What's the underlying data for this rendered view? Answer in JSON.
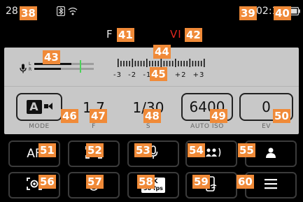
{
  "status": {
    "shots_left": "28",
    "bluetooth_icon": "bluetooth-icon",
    "wifi_icon": "wifi-icon",
    "time": "02:1",
    "battery_icon": "battery-icon"
  },
  "modes": {
    "photo_label": "F",
    "video_label": "VI"
  },
  "audio": {
    "mic_icon": "microphone-icon",
    "left_channel": "L",
    "right_channel": "R",
    "left_level": 0.62,
    "right_level": 0.45
  },
  "ev_scale": {
    "labels": [
      "-3",
      "-2",
      "-1",
      "",
      "+2",
      "+3"
    ]
  },
  "exposure": {
    "mode_value": "A",
    "mode_caption": "MODE",
    "aperture_value": "1.7",
    "aperture_caption": "F",
    "shutter_value": "1/30",
    "shutter_caption": "S",
    "iso_value": "6400",
    "iso_caption": "AUTO ISO",
    "ev_value": "0",
    "ev_caption": "EV"
  },
  "tiles": {
    "af_label": "AF",
    "video_format_top": "4K",
    "video_format_bottom": "30 fps"
  },
  "markers": [
    "38",
    "39",
    "40",
    "41",
    "42",
    "43",
    "44",
    "45",
    "46",
    "47",
    "48",
    "49",
    "50",
    "51",
    "52",
    "53",
    "54",
    "55",
    "56",
    "57",
    "58",
    "59",
    "60"
  ],
  "colors": {
    "marker": "#f08a38",
    "video_red": "#e0261e",
    "level_green": "#4cd35a",
    "panel": "#c8c8c8"
  }
}
